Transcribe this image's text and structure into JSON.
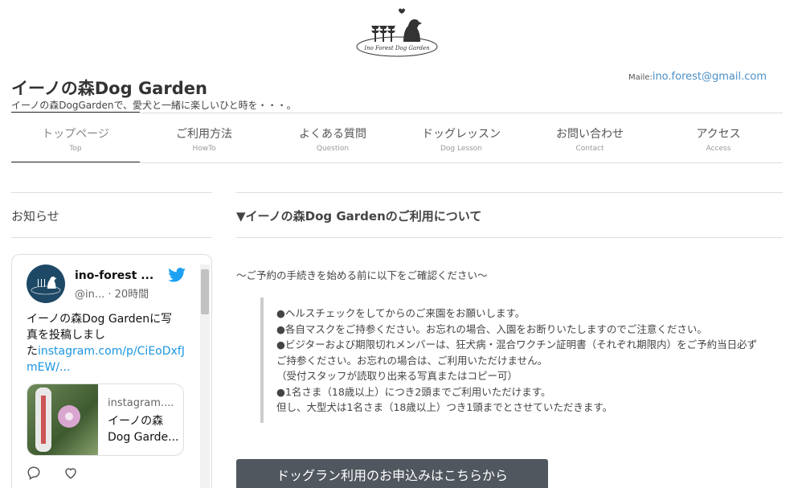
{
  "header": {
    "logo_text": "Ino Forest Dog Garden",
    "site_title": "イーノの森Dog Garden",
    "tagline": "イーノの森DogGardenで、愛犬と一緒に楽しいひと時を・・・。",
    "mail_label": "Maile:",
    "mail_address": "ino.forest@gmail.com"
  },
  "nav": {
    "items": [
      {
        "jp": "トップページ",
        "en": "Top"
      },
      {
        "jp": "ご利用方法",
        "en": "HowTo"
      },
      {
        "jp": "よくある質問",
        "en": "Question"
      },
      {
        "jp": "ドッグレッスン",
        "en": "Dog Lesson"
      },
      {
        "jp": "お問い合わせ",
        "en": "Contact"
      },
      {
        "jp": "アクセス",
        "en": "Access"
      }
    ]
  },
  "sidebar": {
    "heading": "お知らせ",
    "tweet": {
      "name": "ino-forest ...",
      "handle": "@in... · 20時間",
      "text_line1": "イーノの森Dog Gardenに写",
      "text_line2": "真を投稿しまし",
      "text_line3_prefix": "た",
      "link_line1": "instagram.com/p/CiEoDxfJ",
      "link_line2": "mEW/...",
      "media_domain": "instagram....",
      "media_title_line1": "イーノの森",
      "media_title_line2": "Dog Garde..."
    }
  },
  "main": {
    "heading": "▼イーノの森Dog Gardenのご利用について",
    "intro": "～ご予約の手続きを始める前に以下をご確認ください～",
    "notes": [
      "●ヘルスチェックをしてからのご来園をお願いします。",
      "●各自マスクをご持参ください。お忘れの場合、入園をお断りいたしますのでご注意ください。",
      "●ビジターおよび期限切れメンバーは、狂犬病・混合ワクチン証明書（それぞれ期限内）をご予約当日必ず",
      "ご持参ください。お忘れの場合は、ご利用いただけません。",
      "（受付スタッフが読取り出来る写真またはコピー可）",
      "●1名さま（18歳以上）につき2頭までご利用いただけます。",
      "但し、大型犬は1名さま（18歳以上）つき1頭までとさせていただきます。"
    ],
    "cta_label": "ドッグラン利用のお申込みはこちらから"
  },
  "colors": {
    "link": "#4a90c8",
    "twitter": "#1b95e0",
    "button": "#50575e"
  }
}
